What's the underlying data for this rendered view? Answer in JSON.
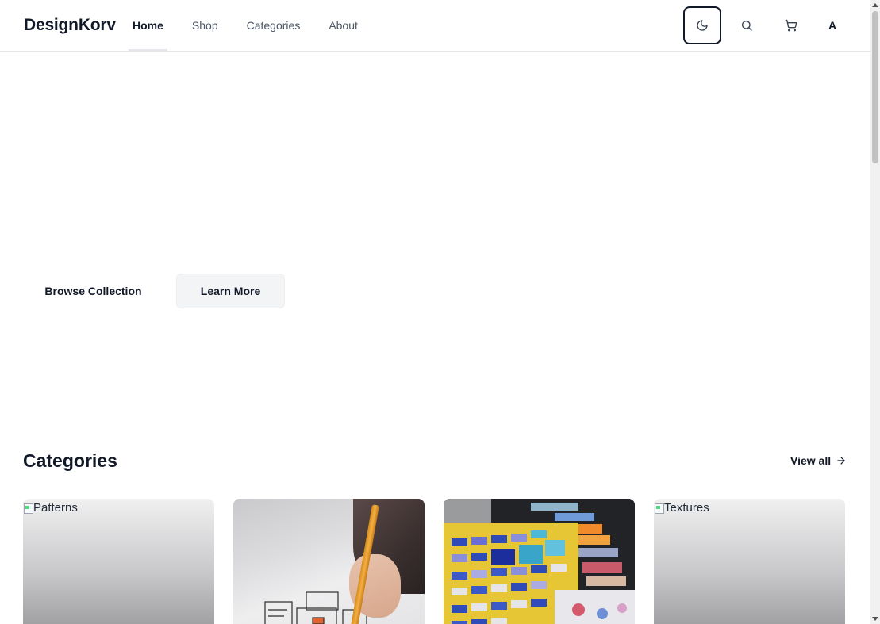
{
  "brand": {
    "name": "DesignKorv"
  },
  "nav": {
    "items": [
      {
        "label": "Home",
        "active": true
      },
      {
        "label": "Shop",
        "active": false
      },
      {
        "label": "Categories",
        "active": false
      },
      {
        "label": "About",
        "active": false
      }
    ]
  },
  "header_actions": {
    "theme_icon": "moon-icon",
    "search_icon": "search-icon",
    "cart_icon": "cart-icon",
    "avatar_initial": "A"
  },
  "hero": {
    "primary_button": "Browse Collection",
    "secondary_button": "Learn More"
  },
  "categories_section": {
    "title": "Categories",
    "view_all": "View all",
    "cards": [
      {
        "alt": "Patterns",
        "image_state": "broken"
      },
      {
        "alt": "",
        "image_state": "photo-sketching"
      },
      {
        "alt": "",
        "image_state": "photo-color-swatches"
      },
      {
        "alt": "Textures",
        "image_state": "broken"
      }
    ]
  },
  "colors": {
    "text_primary": "#111827",
    "text_muted": "#4b5563",
    "border": "#e5e7eb",
    "button_secondary_bg": "#f3f4f6"
  }
}
